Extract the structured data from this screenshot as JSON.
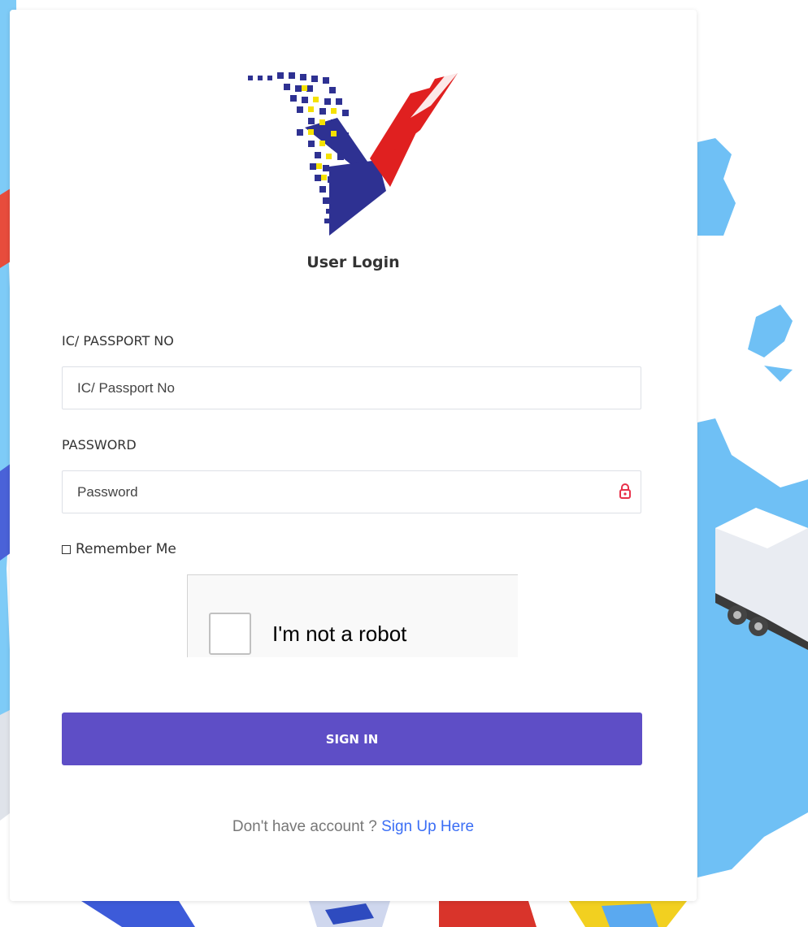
{
  "login": {
    "title": "User Login",
    "ic_label": "IC/ PASSPORT NO",
    "ic_placeholder": "IC/ Passport No",
    "password_label": "PASSWORD",
    "password_placeholder": "Password",
    "remember_label": "Remember Me",
    "recaptcha_label": "I'm not a robot",
    "signin_label": "SIGN IN",
    "signup_prompt": "Don't have account ?",
    "signup_link": "Sign Up Here"
  },
  "icons": {
    "lock": "lock-icon",
    "logo": "logo-emblem"
  },
  "colors": {
    "signin_button": "#5e4ec6",
    "signup_link": "#3b6ef5",
    "lock_icon": "#e8314a",
    "logo_navy": "#2e3192",
    "logo_red": "#e02020",
    "logo_yellow": "#f5e100"
  }
}
